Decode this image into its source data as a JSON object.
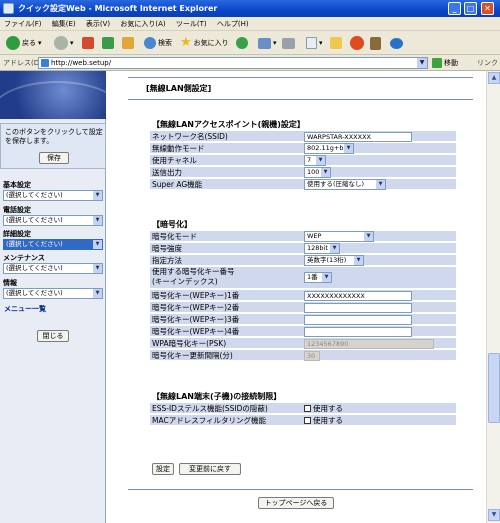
{
  "window": {
    "title": "クイック設定Web - Microsoft Internet Explorer"
  },
  "menu": [
    "ファイル(F)",
    "編集(E)",
    "表示(V)",
    "お気に入り(A)",
    "ツール(T)",
    "ヘルプ(H)"
  ],
  "toolbar": {
    "back": "戻る",
    "search": "検索",
    "favorites": "お気に入り"
  },
  "address": {
    "label": "アドレス(D)",
    "url": "http://web.setup/",
    "go": "移動",
    "links": "リンク"
  },
  "sidebar": {
    "save_note": "このボタンをクリックして設定を保存します。",
    "save_button": "保存",
    "nav": [
      {
        "label": "基本設定",
        "value": "(選択してください)"
      },
      {
        "label": "電話設定",
        "value": "(選択してください)"
      },
      {
        "label": "詳細設定",
        "value": "(選択してください)"
      },
      {
        "label": "メンテナンス",
        "value": "(選択してください)"
      },
      {
        "label": "情報",
        "value": "(選択してください)"
      }
    ],
    "menu_list": "メニュー一覧",
    "close_button": "閉じる"
  },
  "main": {
    "page_title": "[無線LAN側設定]",
    "ap_section": "【無線LANアクセスポイント(親機)設定】",
    "ssid_label": "ネットワーク名(SSID)",
    "ssid_value": "WARPSTAR-XXXXXX",
    "mode_label": "無線動作モード",
    "mode_value": "802.11g+b",
    "channel_label": "使用チャネル",
    "channel_value": "7",
    "power_label": "送信出力",
    "power_value": "100",
    "superag_label": "Super AG機能",
    "superag_value": "使用する(圧縮なし)",
    "enc_section": "【暗号化】",
    "encmode_label": "暗号化モード",
    "encmode_value": "WEP",
    "strength_label": "暗号強度",
    "strength_value": "128bit",
    "method_label": "指定方法",
    "method_value": "英数字(13桁)",
    "keyidx_label1": "使用する暗号化キー番号",
    "keyidx_label2": "(キーインデックス)",
    "keyidx_value": "1番",
    "key1_label": "暗号化キー(WEPキー)1番",
    "key1_value": "XXXXXXXXXXXXX",
    "key2_label": "暗号化キー(WEPキー)2番",
    "key2_value": "",
    "key3_label": "暗号化キー(WEPキー)3番",
    "key3_value": "",
    "key4_label": "暗号化キー(WEPキー)4番",
    "key4_value": "",
    "psk_label": "WPA暗号化キー(PSK)",
    "psk_value": "1234567890",
    "interval_label": "暗号化キー更新間隔(分)",
    "interval_value": "30",
    "client_section": "【無線LAN端末(子機)の接続制限】",
    "stealth_label": "ESS-IDステルス機能(SSIDの隠蔽)",
    "stealth_check": "使用する",
    "mac_label": "MACアドレスフィルタリング機能",
    "mac_check": "使用する",
    "set_button": "設定",
    "revert_button": "変更前に戻す",
    "top_button": "トップページへ戻る"
  }
}
